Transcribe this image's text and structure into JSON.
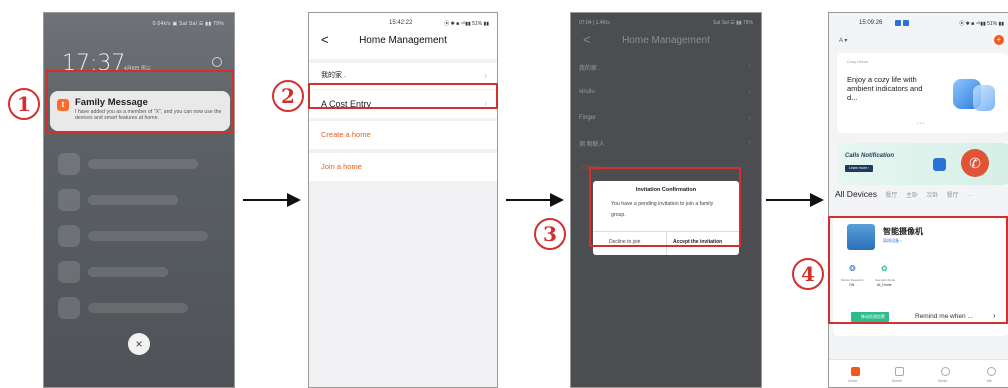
{
  "steps": [
    "1",
    "2",
    "3",
    "4"
  ],
  "phone1": {
    "status": "0.04k/s ▣ Sal Sal ☰ ▮▮ 79%",
    "time": "17:37",
    "date": "4月8日 周三",
    "notification": {
      "icon": "tuya-app-icon",
      "title": "Family Message",
      "body": "I have added you as a member of \"X\", and you can now use the devices and smart features at home."
    },
    "close_icon": "×"
  },
  "phone2": {
    "status_time": "15:42:22",
    "status_right": "⦿ ✱ ■ ⁴ᴳ▮▮ 51% ▮▮",
    "title": "Home Management",
    "back": "<",
    "rows": [
      {
        "label": "我的家 ."
      },
      {
        "label": "A  Cost Entry"
      }
    ],
    "create_home": "Create a home",
    "join_home": "Join a home"
  },
  "phone3": {
    "status_left": "07:04 | 1.4K/s",
    "status_right": "Sal Sal ☰ ▮▮ 79%",
    "title": "Home Management",
    "back": "<",
    "rows": [
      "我的家 .",
      "xiruilu",
      "Finger",
      "测 物联人",
      "创建家庭"
    ],
    "dialog": {
      "title": "Invitation Confirmation",
      "message": "You have a pending invitation to join a family group.",
      "decline": "Decline to join",
      "accept": "Accept the invitation"
    }
  },
  "phone4": {
    "status_time": "15:09:26",
    "status_right": "⦿ ✱ ■ ⁴ᴳ▮▮ 51% ▮▮",
    "home_label": "A ▾",
    "cozy_header": "Cozy Home",
    "cozy_text": "Enjoy a cozy life with ambient indicators and d...",
    "calls_title": "Calls Notification",
    "calls_btn": "Learn more ›",
    "tabs": [
      "All Devices",
      "餐厅",
      "主卧",
      "次卧",
      "餐厅",
      "···"
    ],
    "device": {
      "name": "智能摄像机",
      "status": "离线设备 ›",
      "motion_label": "Motion Detection",
      "motion_value": "ON",
      "scene_label": "Scenario Mode",
      "scene_value": "At_Home",
      "chip": "移动侦测告警",
      "remind": "Remind me when ...",
      "remind_arrow": "›"
    },
    "bottom_nav": [
      "Home",
      "Scene",
      "Smart",
      "Me"
    ]
  },
  "colors": {
    "highlight": "#d32f2f",
    "orange": "#f25a1d",
    "teal": "#2dbb8f"
  }
}
